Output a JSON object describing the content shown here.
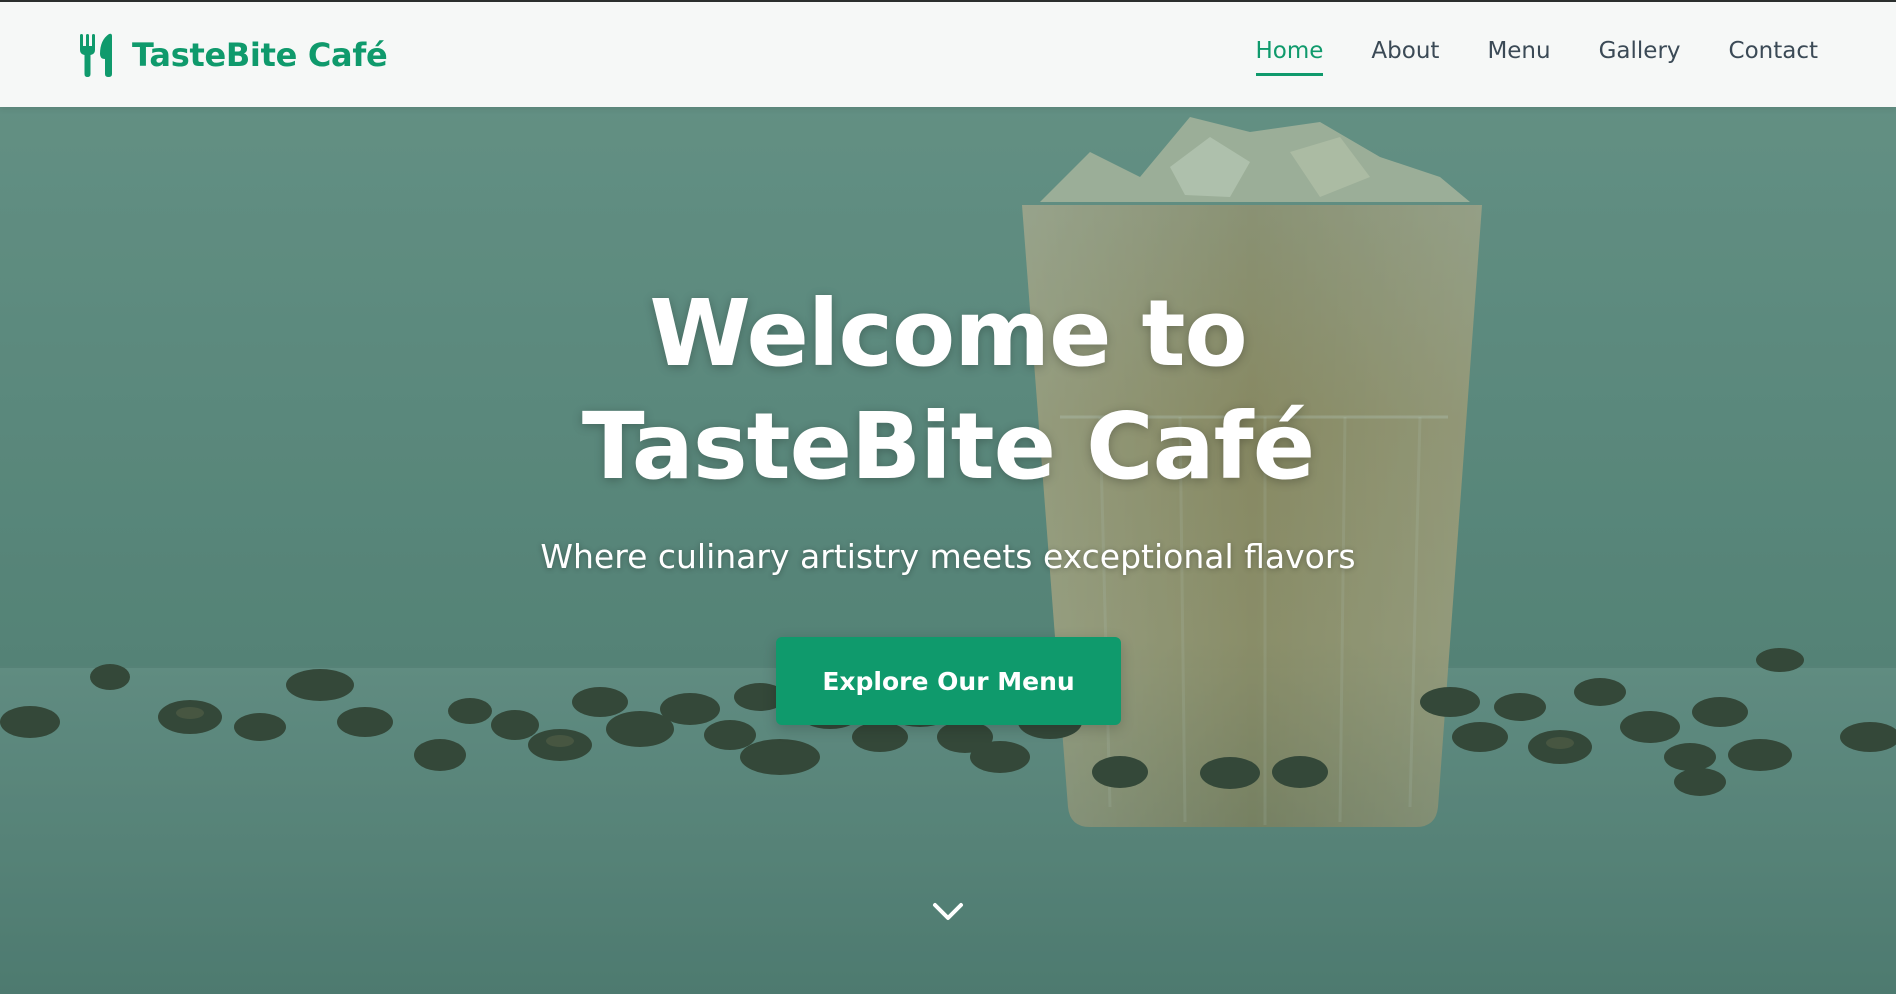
{
  "header": {
    "brand": "TasteBite Café",
    "logo_icon": "utensils-icon",
    "brand_color": "#0f9a6c",
    "nav": [
      {
        "label": "Home",
        "active": true
      },
      {
        "label": "About",
        "active": false
      },
      {
        "label": "Menu",
        "active": false
      },
      {
        "label": "Gallery",
        "active": false
      },
      {
        "label": "Contact",
        "active": false
      }
    ]
  },
  "hero": {
    "title": "Welcome to TasteBite Café",
    "subtitle": "Where culinary artistry meets exceptional flavors",
    "cta_label": "Explore Our Menu",
    "scroll_icon": "chevron-down-icon",
    "background_image": "iced coffee glass with coffee beans"
  }
}
